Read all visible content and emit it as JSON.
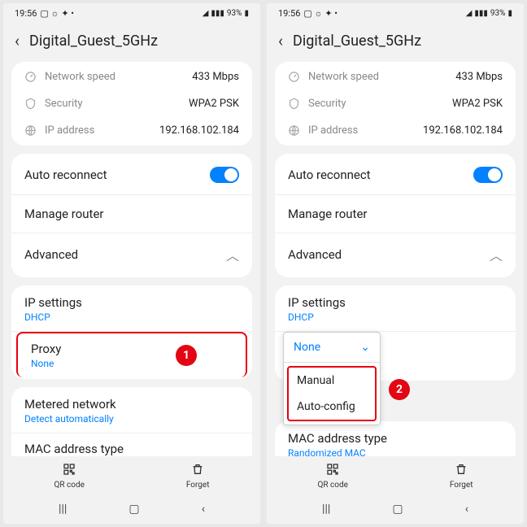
{
  "status": {
    "time": "19:56",
    "battery": "93%"
  },
  "header": {
    "title": "Digital_Guest_5GHz"
  },
  "info": {
    "speed_label": "Network speed",
    "speed_value": "433 Mbps",
    "security_label": "Security",
    "security_value": "WPA2 PSK",
    "ip_label": "IP address",
    "ip_value": "192.168.102.184"
  },
  "settings": {
    "auto_reconnect": "Auto reconnect",
    "manage_router": "Manage router",
    "advanced": "Advanced"
  },
  "ip_settings": {
    "label": "IP settings",
    "value": "DHCP"
  },
  "proxy": {
    "label": "Proxy",
    "value": "None"
  },
  "dropdown": {
    "selected": "None",
    "opt1": "Manual",
    "opt2": "Auto-config"
  },
  "metered": {
    "label": "Metered network",
    "value": "Detect automatically"
  },
  "mac": {
    "label": "MAC address type",
    "value": "Randomized MAC"
  },
  "actions": {
    "qr": "QR code",
    "forget": "Forget"
  },
  "badges": {
    "one": "1",
    "two": "2"
  }
}
